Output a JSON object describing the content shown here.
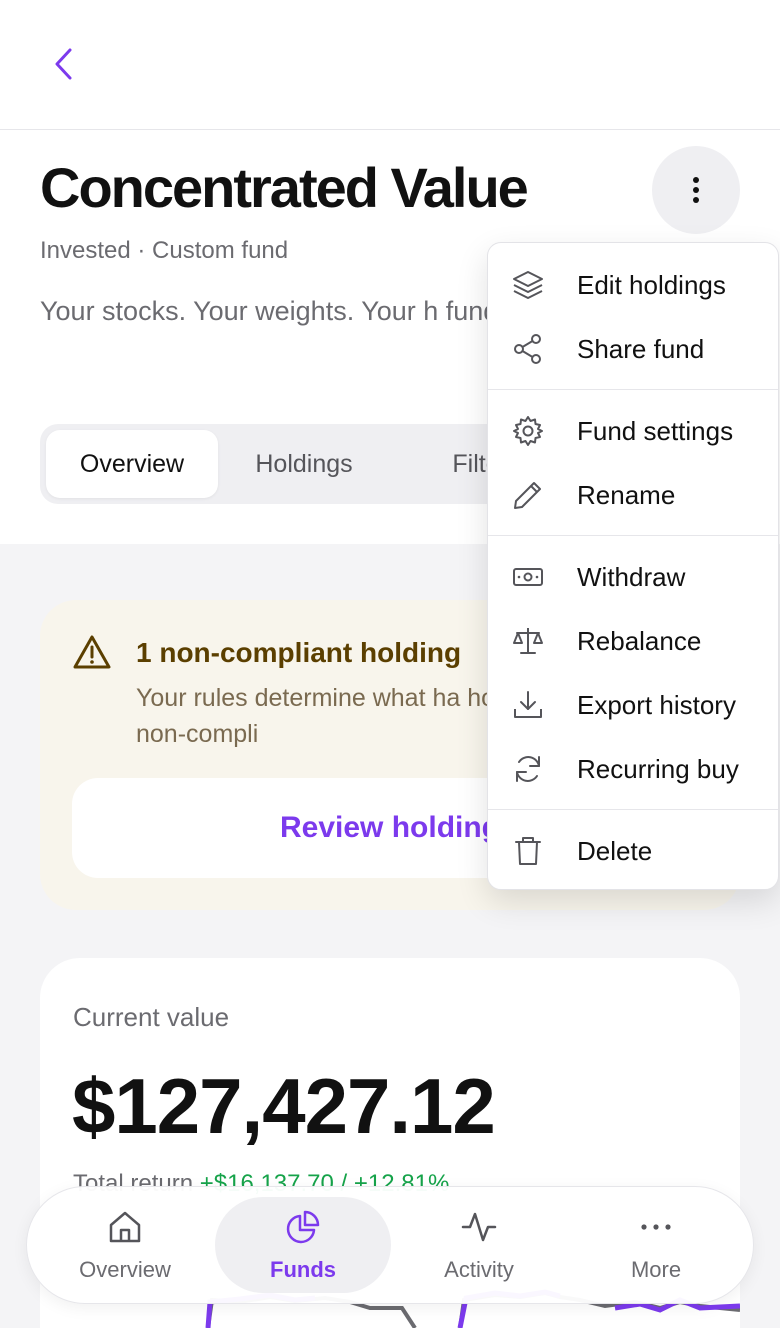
{
  "header": {
    "title": "Concentrated Value",
    "subtitle": "Invested · Custom fund",
    "description": "Your stocks. Your weights. Your h fund."
  },
  "tabs": [
    {
      "label": "Overview",
      "active": true
    },
    {
      "label": "Holdings",
      "active": false
    },
    {
      "label": "Filte",
      "active": false
    }
  ],
  "alert": {
    "title": "1 non-compliant holding",
    "body": "Your rules determine what ha holding becomes non-compli",
    "button_label": "Review holding"
  },
  "value_card": {
    "label": "Current value",
    "amount": "$127,427.12",
    "total_return_label": "Total return",
    "total_return_value": "+$16,137.70 / +12.81%"
  },
  "menu": {
    "items": [
      {
        "label": "Edit holdings",
        "icon": "layers-icon"
      },
      {
        "label": "Share fund",
        "icon": "share-icon"
      },
      {
        "label": "Fund settings",
        "icon": "gear-icon"
      },
      {
        "label": "Rename",
        "icon": "pencil-icon"
      },
      {
        "label": "Withdraw",
        "icon": "banknote-icon"
      },
      {
        "label": "Rebalance",
        "icon": "scale-icon"
      },
      {
        "label": "Export history",
        "icon": "download-icon"
      },
      {
        "label": "Recurring buy",
        "icon": "refresh-icon"
      },
      {
        "label": "Delete",
        "icon": "trash-icon"
      }
    ]
  },
  "bottom_nav": {
    "items": [
      {
        "label": "Overview",
        "icon": "home-icon",
        "active": false
      },
      {
        "label": "Funds",
        "icon": "pie-chart-icon",
        "active": true
      },
      {
        "label": "Activity",
        "icon": "activity-icon",
        "active": false
      },
      {
        "label": "More",
        "icon": "more-horizontal-icon",
        "active": false
      }
    ]
  },
  "colors": {
    "accent": "#7c3aed",
    "positive": "#16a34a",
    "warning_bg": "#f8f5ec",
    "warning_text": "#5b3f00"
  }
}
